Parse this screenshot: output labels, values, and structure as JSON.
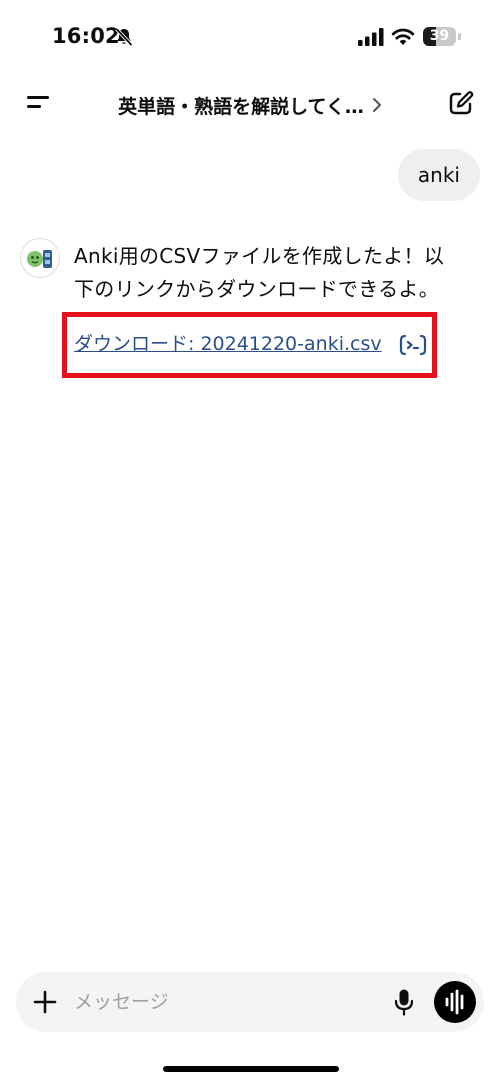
{
  "status_bar": {
    "time": "16:02",
    "battery_percent": "39",
    "battery_level": 0.39,
    "icons": [
      "bell-slash-icon",
      "cellular-signal-icon",
      "wifi-icon",
      "battery-icon"
    ]
  },
  "header": {
    "title": "英単語・熟語を解説してく…",
    "icons": [
      "menu-icon",
      "chevron-right-icon",
      "compose-icon"
    ]
  },
  "chat": {
    "user_message": "anki",
    "assistant_message": "Anki用のCSVファイルを作成したよ！以下のリンクからダウンロードできるよ。",
    "download_link": "ダウンロード: 20241220-anki.csv",
    "icons": [
      "assistant-avatar-icon",
      "code-interpreter-icon"
    ]
  },
  "composer": {
    "placeholder": "メッセージ",
    "value": "",
    "icons": [
      "plus-icon",
      "microphone-icon",
      "voice-waveform-icon"
    ]
  },
  "colors": {
    "background": "#ffffff",
    "text": "#0d0d0d",
    "user_bubble": "#efefef",
    "link": "#2b4e8c",
    "highlight_border": "#e8101a",
    "composer_bg": "#f4f4f4",
    "placeholder": "#a0a0a0"
  }
}
